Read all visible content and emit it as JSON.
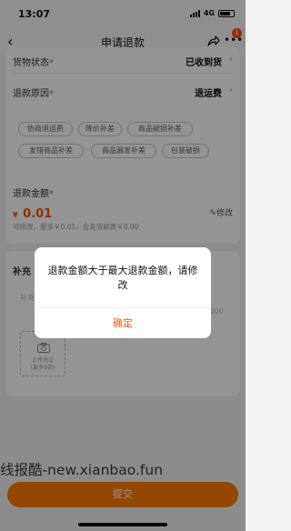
{
  "status_bar": {
    "time": "13:07",
    "network": "4G"
  },
  "nav": {
    "back_icon": "chevron-left-icon",
    "title": "申请退款",
    "share_icon": "share-icon",
    "more_icon": "more-icon",
    "badge": "1"
  },
  "form": {
    "goods_status": {
      "label": "货物状态",
      "required": "*",
      "value": "已收到货"
    },
    "refund_reason": {
      "label": "退款原因",
      "required": "*",
      "value": "退运费"
    },
    "reason_tags": [
      "协商退运费",
      "降价补差",
      "商品破损补差",
      "发错商品补差",
      "商品漏发补差",
      "包装破损"
    ],
    "refund_amount": {
      "label": "退款金额",
      "required": "*",
      "currency": "¥",
      "value": "0.01",
      "edit_label": "修改",
      "hint": "可修改，最多￥0.01，含发货邮费￥0.00"
    },
    "supplement": {
      "title": "补充",
      "placeholder": "补充",
      "count": "200",
      "upload_label": "上传凭证",
      "upload_sub": "(最多9张)"
    },
    "submit_label": "提交"
  },
  "dialog": {
    "message": "退款金额大于最大退款金额，请修改",
    "confirm_label": "确定"
  },
  "watermark": "线报酷-new.xianbao.fun",
  "colors": {
    "accent": "#ff5000",
    "submit": "#ff7a00"
  }
}
